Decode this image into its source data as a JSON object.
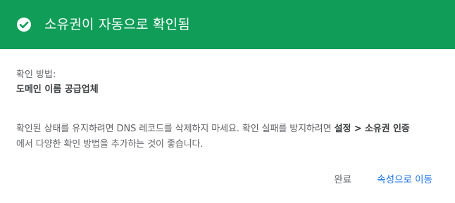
{
  "colors": {
    "header_bg": "#0f9d58",
    "header_text": "#ffffff",
    "secondary_button": "#5f6368",
    "primary_button": "#1a73e8"
  },
  "header": {
    "icon": "check-circle-icon",
    "title": "소유권이 자동으로 확인됨"
  },
  "verification": {
    "method_label": "확인 방법:",
    "method_value": "도메인 이름 공급업체"
  },
  "note": {
    "text_before": "확인된 상태를 유지하려면 DNS 레코드를 삭제하지 마세요. 확인 실패를 방지하려면 ",
    "link_text": "설정 > 소유권 인증",
    "text_after": "에서 다양한 확인 방법을 추가하는 것이 좋습니다."
  },
  "actions": {
    "done_label": "완료",
    "go_to_label": "속성으로 이동"
  }
}
